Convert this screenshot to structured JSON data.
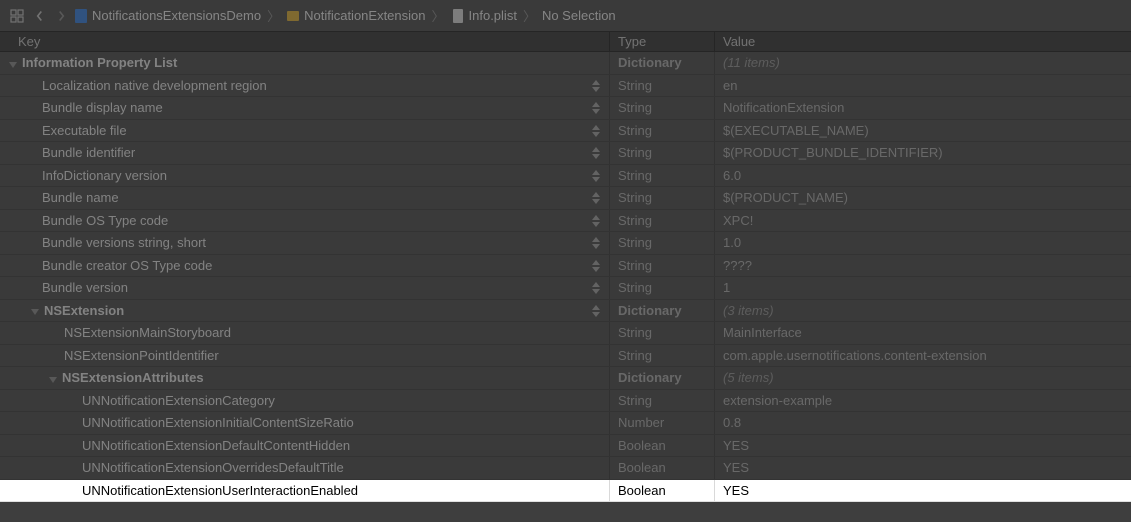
{
  "breadcrumb": {
    "items": [
      {
        "label": "NotificationsExtensionsDemo"
      },
      {
        "label": "NotificationExtension"
      },
      {
        "label": "Info.plist"
      },
      {
        "label": "No Selection"
      }
    ]
  },
  "columns": {
    "key": "Key",
    "type": "Type",
    "value": "Value"
  },
  "rows": [
    {
      "key": "Information Property List",
      "type": "Dictionary",
      "value": "(11 items)",
      "indent": 0,
      "disclosure": true,
      "dict": true
    },
    {
      "key": "Localization native development region",
      "type": "String",
      "value": "en",
      "indent": 1,
      "stepper": true
    },
    {
      "key": "Bundle display name",
      "type": "String",
      "value": "NotificationExtension",
      "indent": 1,
      "stepper": true
    },
    {
      "key": "Executable file",
      "type": "String",
      "value": "$(EXECUTABLE_NAME)",
      "indent": 1,
      "stepper": true
    },
    {
      "key": "Bundle identifier",
      "type": "String",
      "value": "$(PRODUCT_BUNDLE_IDENTIFIER)",
      "indent": 1,
      "stepper": true
    },
    {
      "key": "InfoDictionary version",
      "type": "String",
      "value": "6.0",
      "indent": 1,
      "stepper": true
    },
    {
      "key": "Bundle name",
      "type": "String",
      "value": "$(PRODUCT_NAME)",
      "indent": 1,
      "stepper": true
    },
    {
      "key": "Bundle OS Type code",
      "type": "String",
      "value": "XPC!",
      "indent": 1,
      "stepper": true
    },
    {
      "key": "Bundle versions string, short",
      "type": "String",
      "value": "1.0",
      "indent": 1,
      "stepper": true
    },
    {
      "key": "Bundle creator OS Type code",
      "type": "String",
      "value": "????",
      "indent": 1,
      "stepper": true
    },
    {
      "key": "Bundle version",
      "type": "String",
      "value": "1",
      "indent": 1,
      "stepper": true
    },
    {
      "key": "NSExtension",
      "type": "Dictionary",
      "value": "(3 items)",
      "indent": 1,
      "disclosure": true,
      "stepper": true,
      "dict": true
    },
    {
      "key": "NSExtensionMainStoryboard",
      "type": "String",
      "value": "MainInterface",
      "indent": 2
    },
    {
      "key": "NSExtensionPointIdentifier",
      "type": "String",
      "value": "com.apple.usernotifications.content-extension",
      "indent": 2
    },
    {
      "key": "NSExtensionAttributes",
      "type": "Dictionary",
      "value": "(5 items)",
      "indent": 2,
      "disclosure": true,
      "dict": true
    },
    {
      "key": "UNNotificationExtensionCategory",
      "type": "String",
      "value": "extension-example",
      "indent": 3
    },
    {
      "key": "UNNotificationExtensionInitialContentSizeRatio",
      "type": "Number",
      "value": "0.8",
      "indent": 3
    },
    {
      "key": "UNNotificationExtensionDefaultContentHidden",
      "type": "Boolean",
      "value": "YES",
      "indent": 3
    },
    {
      "key": "UNNotificationExtensionOverridesDefaultTitle",
      "type": "Boolean",
      "value": "YES",
      "indent": 3
    },
    {
      "key": "UNNotificationExtensionUserInteractionEnabled",
      "type": "Boolean",
      "value": "YES",
      "indent": 3,
      "highlighted": true
    }
  ]
}
